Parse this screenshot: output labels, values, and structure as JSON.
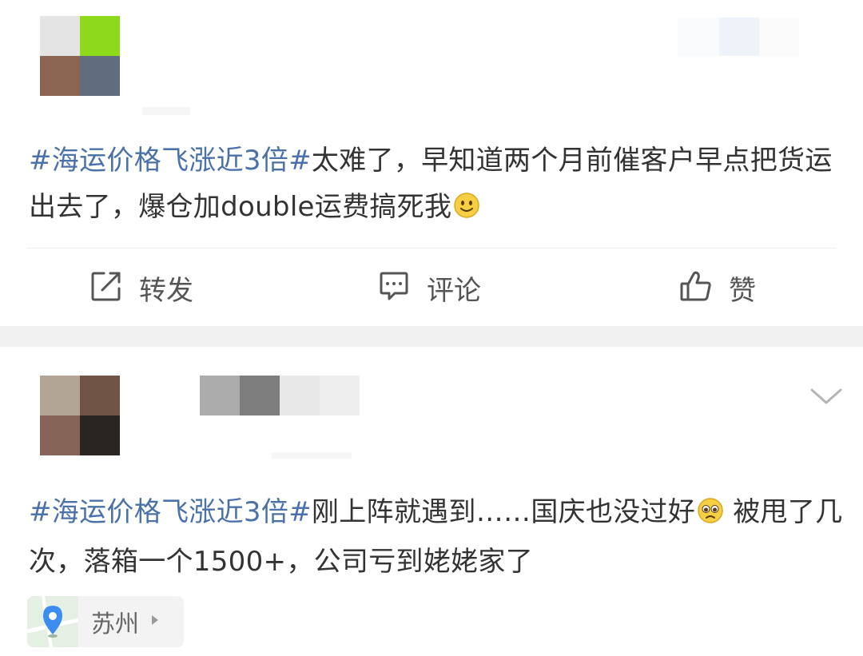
{
  "posts": [
    {
      "avatar_colors": [
        "#e4e4e4",
        "#8ed91a",
        "#8b6452",
        "#616c7f"
      ],
      "topic": "#海运价格飞涨近3倍#",
      "content": "太难了，早知道两个月前催客户早点把货运出去了，爆仓加double运费搞死我",
      "emoji": "smile-emoji",
      "actions": {
        "repost_label": "转发",
        "comment_label": "评论",
        "like_label": "赞"
      }
    },
    {
      "avatar_colors": [
        "#b3a595",
        "#6f5446",
        "#866457",
        "#2b2522"
      ],
      "topic": "#海运价格飞涨近3倍#",
      "content_part1": "刚上阵就遇到……国庆也没过好",
      "content_part2": " 被甩了几次，落箱一个1500+，公司亏到姥姥家了",
      "emoji": "pleading-emoji",
      "location": {
        "label": "苏州",
        "icon": "map-pin-icon"
      },
      "menu_icon": "chevron-down-icon"
    }
  ],
  "colors": {
    "topic": "#4a72a8",
    "text": "#333333",
    "separator": "#f0f0f0",
    "icon": "#555555",
    "pin": "#3d8cf0"
  }
}
